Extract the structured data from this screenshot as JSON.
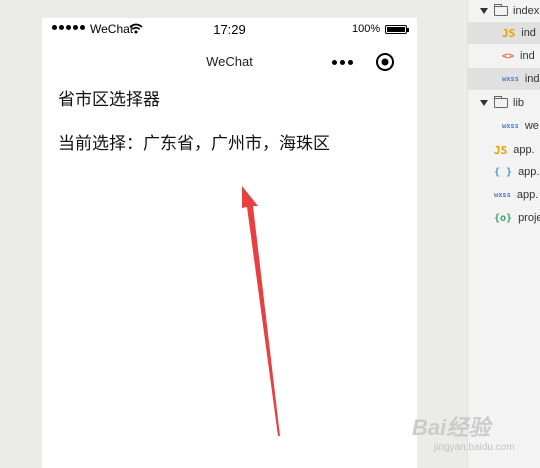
{
  "statusbar": {
    "carrier": "WeChat",
    "time": "17:29",
    "battery": "100%",
    "battery_level": 1.0
  },
  "navbar": {
    "title": "WeChat",
    "more_icon": "more-dots-icon",
    "home_icon": "target-icon"
  },
  "content": {
    "title": "省市区选择器",
    "selection": "当前选择：广东省，广州市，海珠区"
  },
  "annotation": {
    "arrow_color": "#e84040"
  },
  "file_tree": {
    "items": [
      {
        "label": "index",
        "type": "folder",
        "icon": "folder-icon"
      },
      {
        "label": "ind",
        "type": "js",
        "icon": "JS"
      },
      {
        "label": "ind",
        "type": "html",
        "icon": "<>"
      },
      {
        "label": "ind",
        "type": "wxss",
        "icon": "wxss"
      },
      {
        "label": "lib",
        "type": "folder",
        "icon": "folder-icon"
      },
      {
        "label": "we",
        "type": "wxss",
        "icon": "wxss"
      },
      {
        "label": "app.",
        "type": "js",
        "icon": "JS"
      },
      {
        "label": "app.",
        "type": "json",
        "icon": "{ }"
      },
      {
        "label": "app.",
        "type": "wxss",
        "icon": "wxss"
      },
      {
        "label": "proje",
        "type": "proj",
        "icon": "{o}"
      }
    ]
  },
  "watermark": {
    "brand": "Bai",
    "brand_sub": "经验",
    "url": "jingyan.baidu.com"
  }
}
